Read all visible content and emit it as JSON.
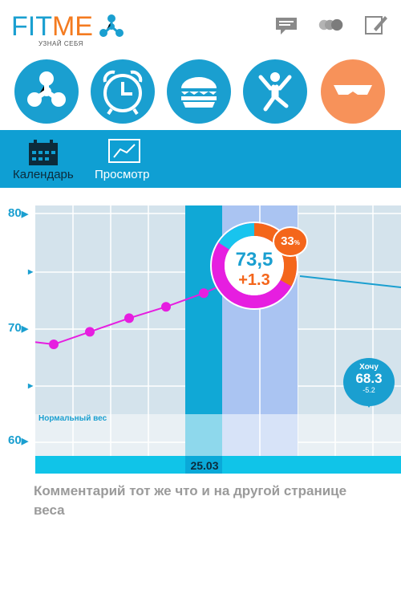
{
  "app": {
    "logo_fit": "FIT",
    "logo_me": "ME",
    "tagline": "УЗНАЙ СЕБЯ"
  },
  "colors": {
    "brand_blue": "#1a9fd0",
    "brand_orange": "#f47b20",
    "active_category": "#f7925a",
    "magenta": "#e61ee0",
    "tab_strip": "#0f9fd3",
    "chart_bg": "#d4e3ec",
    "selected_column": "#10a8d6",
    "projection_column": "#aac4f2",
    "date_bar": "#10c4e8"
  },
  "header_icons": [
    "chat-icon",
    "toggle-icon",
    "edit-icon"
  ],
  "categories": [
    {
      "icon": "fan-icon"
    },
    {
      "icon": "alarm-clock-icon"
    },
    {
      "icon": "burger-icon"
    },
    {
      "icon": "jumping-person-icon"
    },
    {
      "icon": "body-icon",
      "active": true
    }
  ],
  "tabs": [
    {
      "label": "Календарь",
      "icon": "calendar-icon",
      "active": true
    },
    {
      "label": "Просмотр",
      "icon": "chart-view-icon"
    }
  ],
  "chart": {
    "y_labels": [
      "80",
      "70",
      "60"
    ],
    "normal_weight_label": "Нормальный вес",
    "date_label": "25.03",
    "current": {
      "value": "73,5",
      "delta": "+1.3",
      "percent": "33",
      "percent_sign": "%"
    },
    "target": {
      "label": "Хочу",
      "value": "68.3",
      "delta": "-5.2"
    }
  },
  "chart_data": {
    "type": "line",
    "x_labels": [
      "25.03"
    ],
    "series": [
      {
        "values": [
          68.5,
          68.3,
          69.4,
          70.6,
          71.6,
          72.8,
          73.5
        ]
      }
    ],
    "ylim": [
      58.5,
      80.5
    ],
    "y_ticks": [
      80,
      70,
      60
    ]
  },
  "comment": "Комментарий тот же что и на другой странице веса"
}
